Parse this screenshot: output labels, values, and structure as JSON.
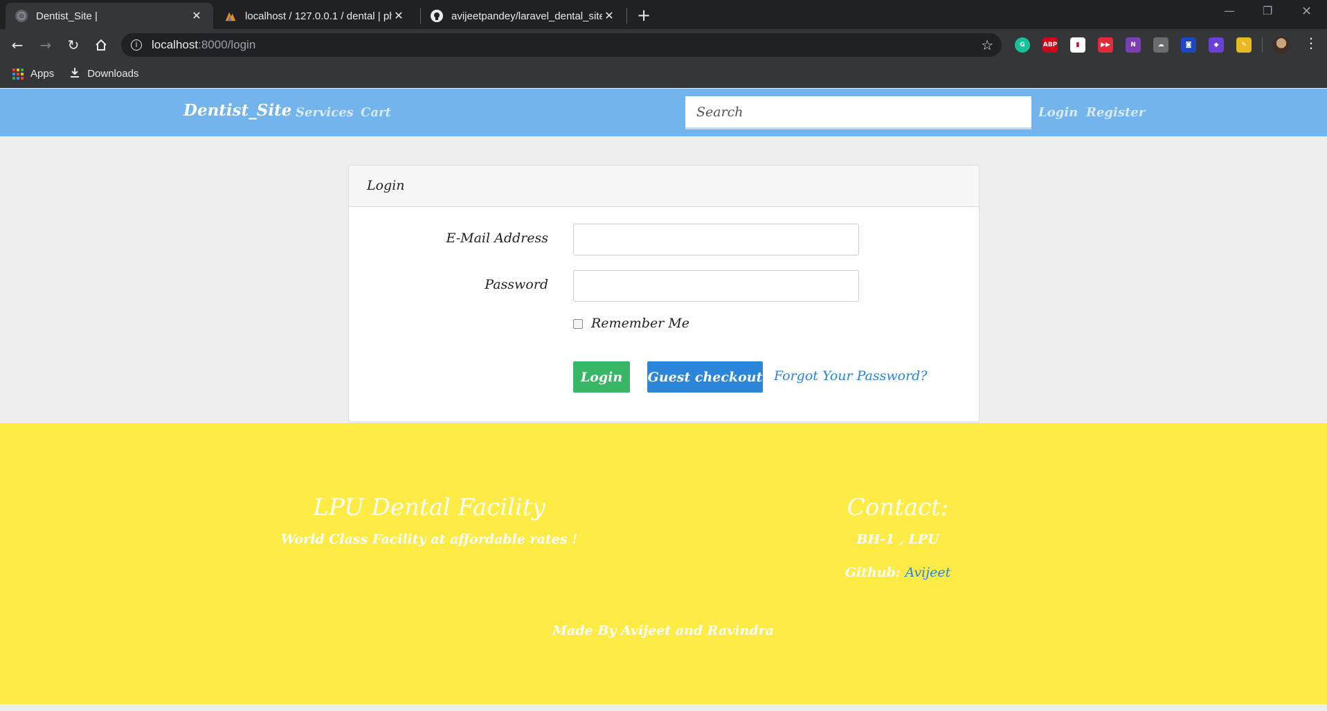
{
  "browser": {
    "tabs": [
      {
        "title": "Dentist_Site |",
        "icon": "globe-icon"
      },
      {
        "title": "localhost / 127.0.0.1 / dental | ph",
        "icon": "phpmyadmin-icon"
      },
      {
        "title": "avijeetpandey/laravel_dental_site",
        "icon": "github-icon"
      }
    ],
    "url_host": "localhost",
    "url_path": ":8000/login",
    "bookmarks": [
      {
        "label": "Apps",
        "icon": "apps-grid-icon"
      },
      {
        "label": "Downloads",
        "icon": "download-icon"
      }
    ],
    "extensions": [
      {
        "name": "grammarly-icon",
        "glyph": "G",
        "color": "#15c39a"
      },
      {
        "name": "adblock-icon",
        "glyph": "ABP",
        "color": "#d0021b"
      },
      {
        "name": "flag-extension-icon",
        "glyph": "▮",
        "color": "#ffffff"
      },
      {
        "name": "youtube-extension-icon",
        "glyph": "▶▶",
        "color": "#e22b3a"
      },
      {
        "name": "onenote-icon",
        "glyph": "N",
        "color": "#7b3fb3"
      },
      {
        "name": "cloud-extension-icon",
        "glyph": "☁",
        "color": "#6b6d70"
      },
      {
        "name": "screen-extension-icon",
        "glyph": "◙",
        "color": "#1b48c2"
      },
      {
        "name": "cube-extension-icon",
        "glyph": "◆",
        "color": "#6a3fd6"
      },
      {
        "name": "highlighter-icon",
        "glyph": "✎",
        "color": "#e8b923"
      }
    ]
  },
  "nav": {
    "brand": "Dentist_Site",
    "links": [
      "Services",
      "Cart"
    ],
    "search_placeholder": "Search",
    "login": "Login",
    "register": "Register"
  },
  "login_card": {
    "title": "Login",
    "email_label": "E-Mail Address",
    "password_label": "Password",
    "remember_label": "Remember Me",
    "login_button": "Login",
    "guest_button": "Guest checkout",
    "forgot_link": "Forgot Your Password?"
  },
  "footer": {
    "left_title": "LPU Dental Facility",
    "left_sub": "World Class Facility at affordable rates !",
    "right_title": "Contact:",
    "address": "BH-1 , LPU",
    "github_label": "Github:",
    "github_link": "Avijeet",
    "credit": "Made By Avijeet and Ravindra"
  },
  "colors": {
    "navbar": "#74b4ec",
    "footer": "#feeb46",
    "login_button": "#37b765",
    "guest_button": "#2b86d9"
  }
}
